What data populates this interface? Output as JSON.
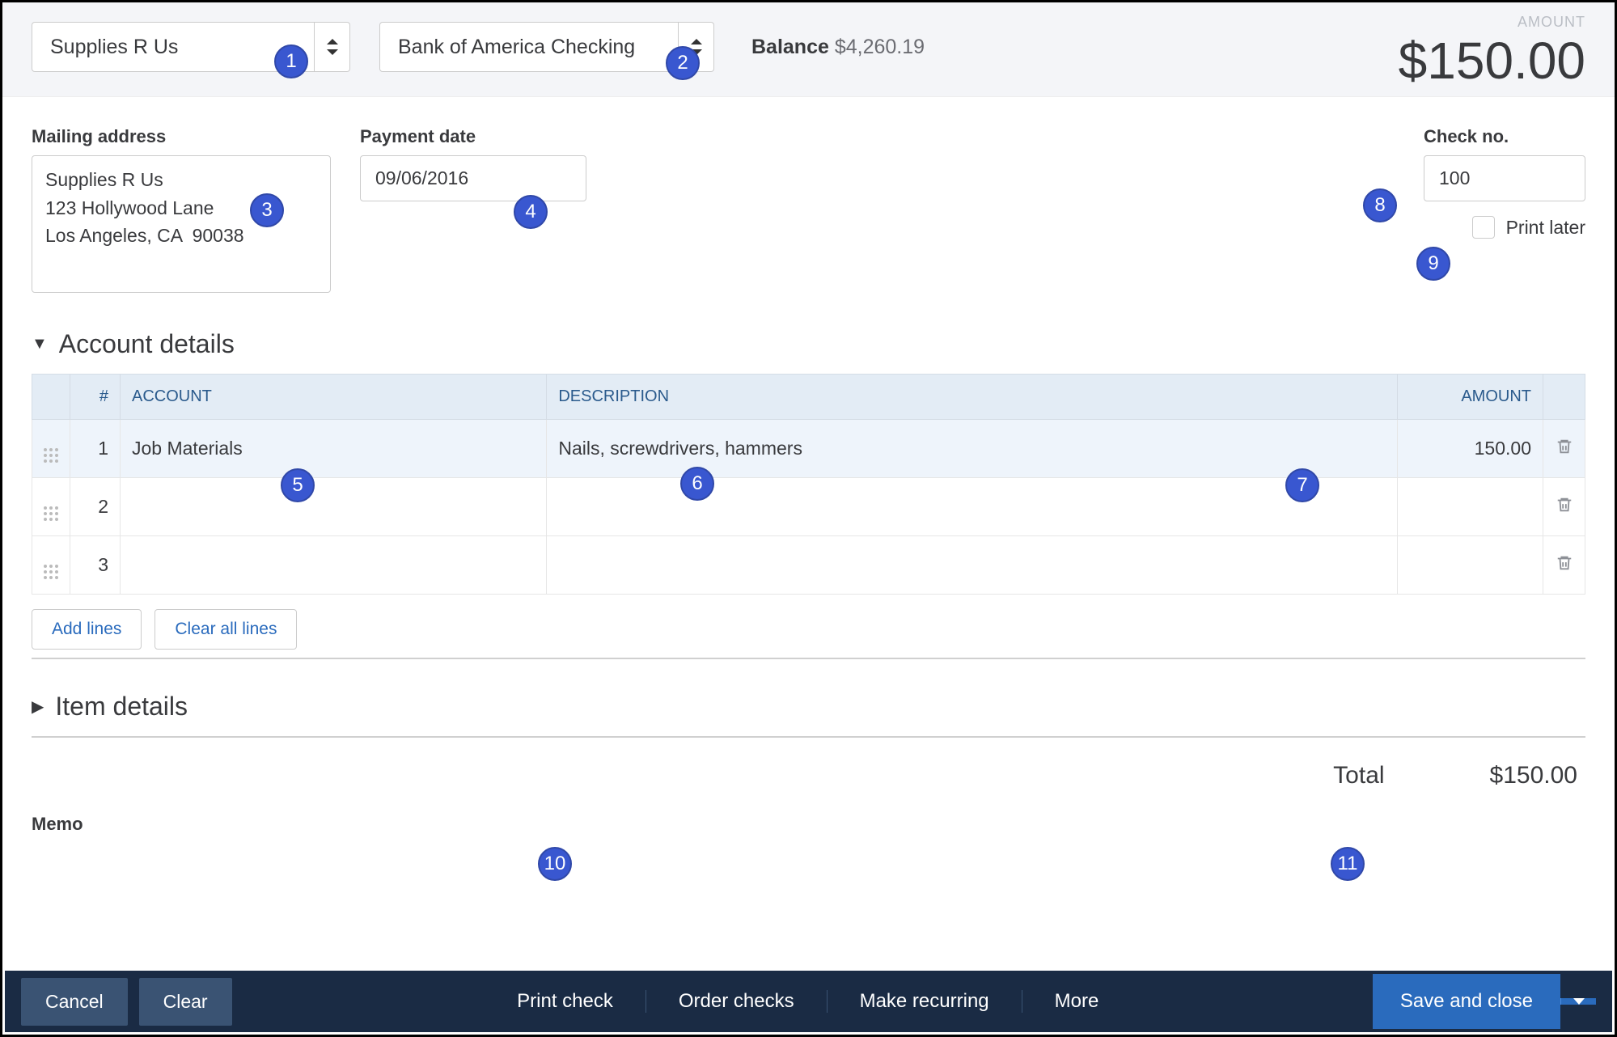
{
  "header": {
    "payee": "Supplies R Us",
    "account": "Bank of America Checking",
    "balance_label": "Balance",
    "balance_value": "$4,260.19",
    "amount_label": "AMOUNT",
    "amount_value": "$150.00"
  },
  "fields": {
    "mailing_label": "Mailing address",
    "mailing_value": "Supplies R Us\n123 Hollywood Lane\nLos Angeles, CA  90038",
    "payment_date_label": "Payment date",
    "payment_date_value": "09/06/2016",
    "check_no_label": "Check no.",
    "check_no_value": "100",
    "print_later_label": "Print later"
  },
  "sections": {
    "account_details": "Account details",
    "item_details": "Item details"
  },
  "table": {
    "headers": {
      "num": "#",
      "account": "ACCOUNT",
      "description": "DESCRIPTION",
      "amount": "AMOUNT"
    },
    "rows": [
      {
        "num": "1",
        "account": "Job Materials",
        "description": "Nails, screwdrivers, hammers",
        "amount": "150.00"
      },
      {
        "num": "2",
        "account": "",
        "description": "",
        "amount": ""
      },
      {
        "num": "3",
        "account": "",
        "description": "",
        "amount": ""
      }
    ],
    "add_lines": "Add lines",
    "clear_lines": "Clear all lines"
  },
  "total": {
    "label": "Total",
    "value": "$150.00"
  },
  "memo_label": "Memo",
  "footer": {
    "cancel": "Cancel",
    "clear": "Clear",
    "print_check": "Print check",
    "order_checks": "Order checks",
    "make_recurring": "Make recurring",
    "more": "More",
    "save": "Save and close"
  },
  "badges": {
    "b1": "1",
    "b2": "2",
    "b3": "3",
    "b4": "4",
    "b5": "5",
    "b6": "6",
    "b7": "7",
    "b8": "8",
    "b9": "9",
    "b10": "10",
    "b11": "11"
  }
}
